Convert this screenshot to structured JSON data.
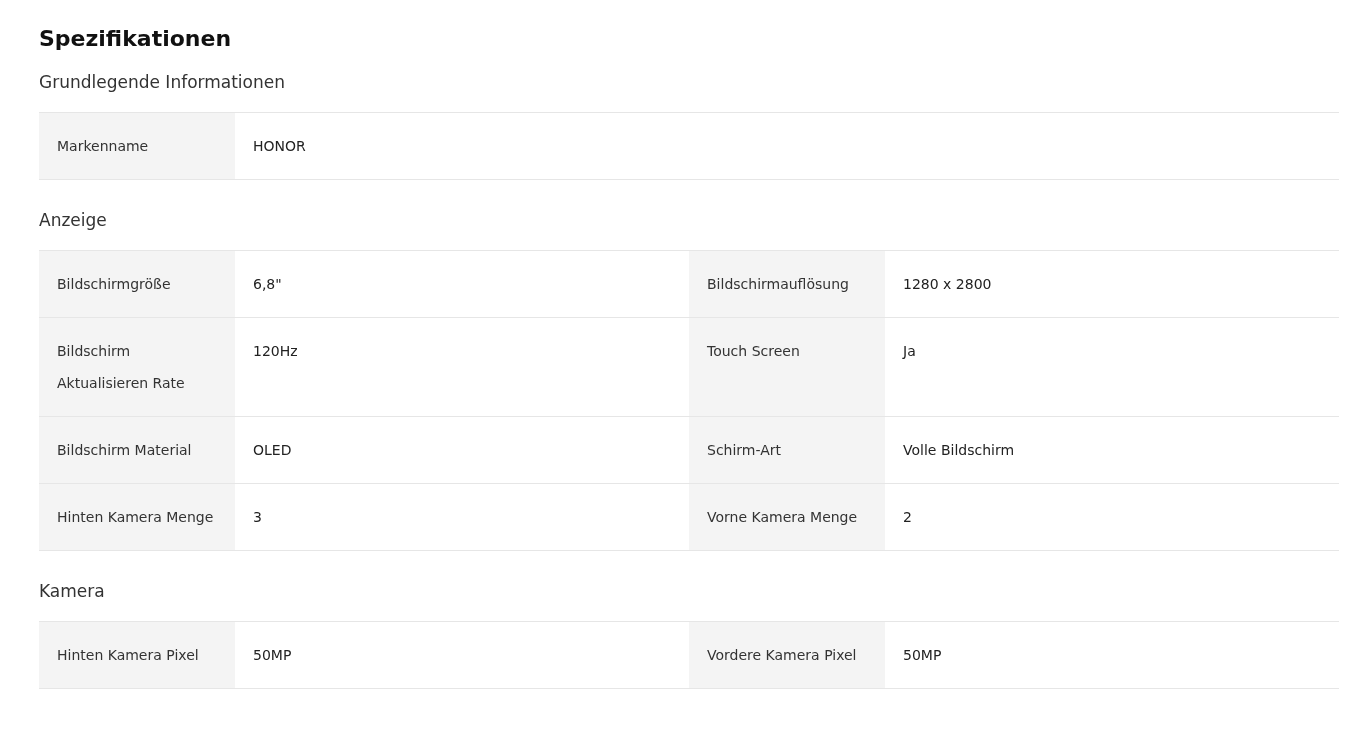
{
  "title": "Spezifikationen",
  "sections": [
    {
      "heading": "Grundlegende Informationen",
      "rows": [
        [
          {
            "label": "Markenname",
            "value": "HONOR"
          }
        ]
      ]
    },
    {
      "heading": "Anzeige",
      "rows": [
        [
          {
            "label": "Bildschirmgröße",
            "value": "6,8\""
          },
          {
            "label": "Bildschirmauflösung",
            "value": "1280 x 2800"
          }
        ],
        [
          {
            "label": "Bildschirm Aktualisieren Rate",
            "value": "120Hz"
          },
          {
            "label": "Touch Screen",
            "value": "Ja"
          }
        ],
        [
          {
            "label": "Bildschirm Material",
            "value": "OLED"
          },
          {
            "label": "Schirm-Art",
            "value": "Volle Bildschirm"
          }
        ],
        [
          {
            "label": "Hinten Kamera Menge",
            "value": "3"
          },
          {
            "label": "Vorne Kamera Menge",
            "value": "2"
          }
        ]
      ]
    },
    {
      "heading": "Kamera",
      "rows": [
        [
          {
            "label": "Hinten Kamera Pixel",
            "value": "50MP"
          },
          {
            "label": "Vordere Kamera Pixel",
            "value": "50MP"
          }
        ]
      ]
    }
  ]
}
